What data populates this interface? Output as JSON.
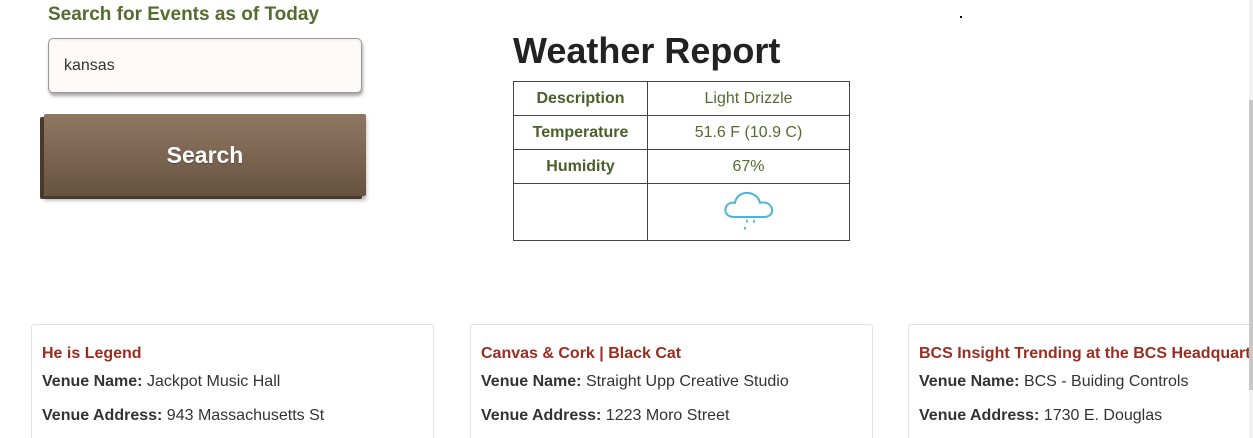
{
  "search": {
    "heading": "Search for Events as of Today",
    "input_value": "kansas",
    "button_label": "Search"
  },
  "weather": {
    "title": "Weather Report",
    "rows": [
      {
        "label": "Description",
        "value": "Light Drizzle"
      },
      {
        "label": "Temperature",
        "value": "51.6 F (10.9 C)"
      },
      {
        "label": "Humidity",
        "value": "67%"
      }
    ],
    "icon": "rain-cloud-icon"
  },
  "events": [
    {
      "title": "He is Legend",
      "venue_name_label": "Venue Name:",
      "venue_name": "Jackpot Music Hall",
      "venue_address_label": "Venue Address:",
      "venue_address": "943 Massachusetts St"
    },
    {
      "title": "Canvas & Cork | Black Cat",
      "venue_name_label": "Venue Name:",
      "venue_name": "Straight Upp Creative Studio",
      "venue_address_label": "Venue Address:",
      "venue_address": "1223 Moro Street"
    },
    {
      "title": "BCS Insight Trending at the BCS Headquarte",
      "venue_name_label": "Venue Name:",
      "venue_name": "BCS - Buiding Controls",
      "venue_address_label": "Venue Address:",
      "venue_address": "1730 E. Douglas"
    }
  ],
  "colors": {
    "heading_green": "#556b2f",
    "button_brown": "#7a6450",
    "event_title_red": "#9b2d20",
    "rain_blue": "#4fb4d8"
  }
}
